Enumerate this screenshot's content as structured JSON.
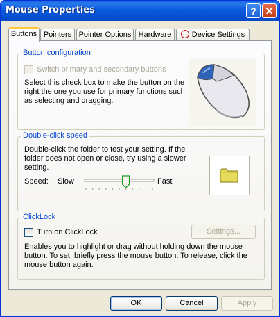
{
  "window": {
    "title": "Mouse Properties"
  },
  "titlebar": {
    "help_label": "?",
    "close_label": "✕"
  },
  "tabs": [
    {
      "label": "Buttons",
      "active": true
    },
    {
      "label": "Pointers"
    },
    {
      "label": "Pointer Options"
    },
    {
      "label": "Hardware"
    },
    {
      "label": "Device Settings"
    }
  ],
  "button_config": {
    "label": "Button configuration",
    "checkbox_label": "Switch primary and secondary buttons",
    "checked": false,
    "description": "Select this check box to make the button on the right the one you use for primary functions such as selecting and dragging."
  },
  "double_click": {
    "label": "Double-click speed",
    "description": "Double-click the folder to test your setting. If the folder does not open or close, try using a slower setting.",
    "speed_label": "Speed:",
    "slow_label": "Slow",
    "fast_label": "Fast",
    "speed_value_fraction": 0.6
  },
  "clicklock": {
    "label": "ClickLock",
    "checkbox_label": "Turn on ClickLock",
    "checked": false,
    "settings_button": "Settings...",
    "description": "Enables you to highlight or drag without holding down the mouse button. To set, briefly press the mouse button. To release, click the mouse button again."
  },
  "footer": {
    "ok": "OK",
    "cancel": "Cancel",
    "apply": "Apply"
  },
  "icons": [
    "mouse-illustration-icon",
    "folder-icon",
    "device-settings-icon"
  ],
  "colors": {
    "title_bar": "#0a5ae0",
    "group_label": "#0046d5",
    "active_tab_highlight": "#ffc83c",
    "dialog_face": "#ece9d8"
  }
}
